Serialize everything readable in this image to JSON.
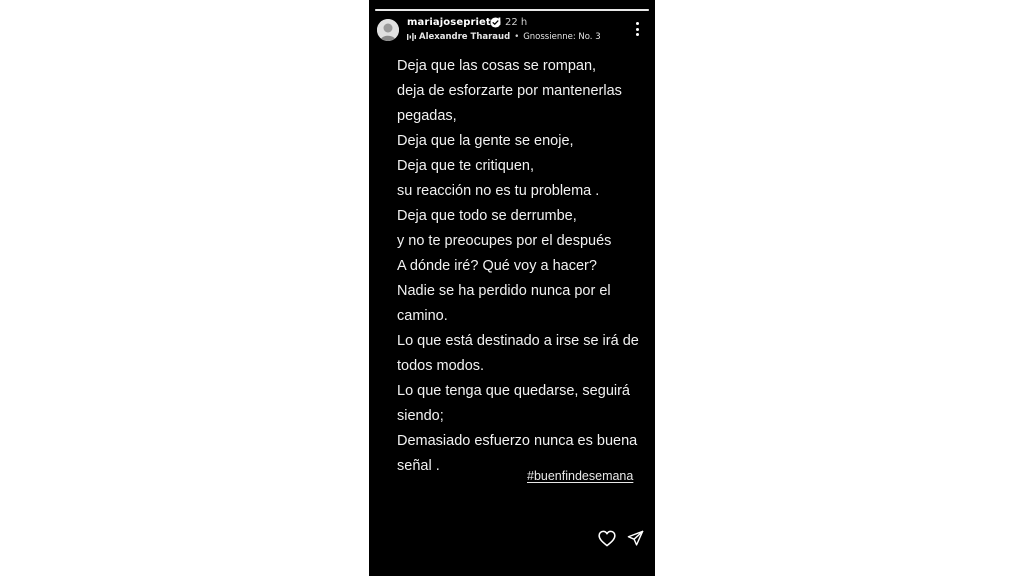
{
  "story": {
    "username": "mariajoseprietol",
    "verified": true,
    "timestamp": "22 h",
    "progress": 1.0,
    "music": {
      "icon": "music-bars-icon",
      "artist": "Alexandre Tharaud",
      "separator": "•",
      "track": "Gnossienne: No. 3"
    },
    "poem_lines": [
      "Deja que las cosas se rompan,",
      "deja de esforzarte por mantenerlas",
      "pegadas,",
      "Deja que la gente se enoje,",
      "Deja que te critiquen,",
      "su reacción no es tu problema .",
      "Deja que todo se derrumbe,",
      "y no te preocupes por el después",
      "A dónde iré? Qué voy a hacer?",
      "Nadie se ha perdido nunca por el",
      "camino.",
      " Lo que está destinado a irse se irá de",
      "todos modos.",
      "Lo que tenga que quedarse, seguirá",
      "siendo;",
      "Demasiado esfuerzo nunca es buena",
      "señal ."
    ],
    "hashtag": "#buenfindesemana",
    "icons": {
      "more": "more-vertical-icon",
      "like": "heart-icon",
      "share": "send-icon"
    },
    "colors": {
      "background": "#000000",
      "text": "#f2f2f2",
      "verified": "#ffffff"
    }
  }
}
